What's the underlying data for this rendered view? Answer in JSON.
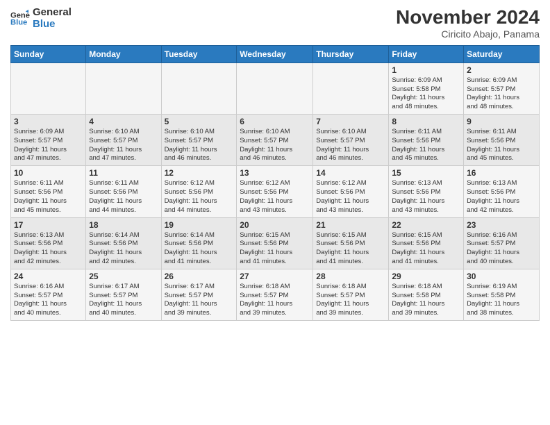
{
  "logo": {
    "line1": "General",
    "line2": "Blue"
  },
  "title": "November 2024",
  "subtitle": "Ciricito Abajo, Panama",
  "weekdays": [
    "Sunday",
    "Monday",
    "Tuesday",
    "Wednesday",
    "Thursday",
    "Friday",
    "Saturday"
  ],
  "weeks": [
    [
      {
        "day": "",
        "info": ""
      },
      {
        "day": "",
        "info": ""
      },
      {
        "day": "",
        "info": ""
      },
      {
        "day": "",
        "info": ""
      },
      {
        "day": "",
        "info": ""
      },
      {
        "day": "1",
        "info": "Sunrise: 6:09 AM\nSunset: 5:58 PM\nDaylight: 11 hours\nand 48 minutes."
      },
      {
        "day": "2",
        "info": "Sunrise: 6:09 AM\nSunset: 5:57 PM\nDaylight: 11 hours\nand 48 minutes."
      }
    ],
    [
      {
        "day": "3",
        "info": "Sunrise: 6:09 AM\nSunset: 5:57 PM\nDaylight: 11 hours\nand 47 minutes."
      },
      {
        "day": "4",
        "info": "Sunrise: 6:10 AM\nSunset: 5:57 PM\nDaylight: 11 hours\nand 47 minutes."
      },
      {
        "day": "5",
        "info": "Sunrise: 6:10 AM\nSunset: 5:57 PM\nDaylight: 11 hours\nand 46 minutes."
      },
      {
        "day": "6",
        "info": "Sunrise: 6:10 AM\nSunset: 5:57 PM\nDaylight: 11 hours\nand 46 minutes."
      },
      {
        "day": "7",
        "info": "Sunrise: 6:10 AM\nSunset: 5:57 PM\nDaylight: 11 hours\nand 46 minutes."
      },
      {
        "day": "8",
        "info": "Sunrise: 6:11 AM\nSunset: 5:56 PM\nDaylight: 11 hours\nand 45 minutes."
      },
      {
        "day": "9",
        "info": "Sunrise: 6:11 AM\nSunset: 5:56 PM\nDaylight: 11 hours\nand 45 minutes."
      }
    ],
    [
      {
        "day": "10",
        "info": "Sunrise: 6:11 AM\nSunset: 5:56 PM\nDaylight: 11 hours\nand 45 minutes."
      },
      {
        "day": "11",
        "info": "Sunrise: 6:11 AM\nSunset: 5:56 PM\nDaylight: 11 hours\nand 44 minutes."
      },
      {
        "day": "12",
        "info": "Sunrise: 6:12 AM\nSunset: 5:56 PM\nDaylight: 11 hours\nand 44 minutes."
      },
      {
        "day": "13",
        "info": "Sunrise: 6:12 AM\nSunset: 5:56 PM\nDaylight: 11 hours\nand 43 minutes."
      },
      {
        "day": "14",
        "info": "Sunrise: 6:12 AM\nSunset: 5:56 PM\nDaylight: 11 hours\nand 43 minutes."
      },
      {
        "day": "15",
        "info": "Sunrise: 6:13 AM\nSunset: 5:56 PM\nDaylight: 11 hours\nand 43 minutes."
      },
      {
        "day": "16",
        "info": "Sunrise: 6:13 AM\nSunset: 5:56 PM\nDaylight: 11 hours\nand 42 minutes."
      }
    ],
    [
      {
        "day": "17",
        "info": "Sunrise: 6:13 AM\nSunset: 5:56 PM\nDaylight: 11 hours\nand 42 minutes."
      },
      {
        "day": "18",
        "info": "Sunrise: 6:14 AM\nSunset: 5:56 PM\nDaylight: 11 hours\nand 42 minutes."
      },
      {
        "day": "19",
        "info": "Sunrise: 6:14 AM\nSunset: 5:56 PM\nDaylight: 11 hours\nand 41 minutes."
      },
      {
        "day": "20",
        "info": "Sunrise: 6:15 AM\nSunset: 5:56 PM\nDaylight: 11 hours\nand 41 minutes."
      },
      {
        "day": "21",
        "info": "Sunrise: 6:15 AM\nSunset: 5:56 PM\nDaylight: 11 hours\nand 41 minutes."
      },
      {
        "day": "22",
        "info": "Sunrise: 6:15 AM\nSunset: 5:56 PM\nDaylight: 11 hours\nand 41 minutes."
      },
      {
        "day": "23",
        "info": "Sunrise: 6:16 AM\nSunset: 5:57 PM\nDaylight: 11 hours\nand 40 minutes."
      }
    ],
    [
      {
        "day": "24",
        "info": "Sunrise: 6:16 AM\nSunset: 5:57 PM\nDaylight: 11 hours\nand 40 minutes."
      },
      {
        "day": "25",
        "info": "Sunrise: 6:17 AM\nSunset: 5:57 PM\nDaylight: 11 hours\nand 40 minutes."
      },
      {
        "day": "26",
        "info": "Sunrise: 6:17 AM\nSunset: 5:57 PM\nDaylight: 11 hours\nand 39 minutes."
      },
      {
        "day": "27",
        "info": "Sunrise: 6:18 AM\nSunset: 5:57 PM\nDaylight: 11 hours\nand 39 minutes."
      },
      {
        "day": "28",
        "info": "Sunrise: 6:18 AM\nSunset: 5:57 PM\nDaylight: 11 hours\nand 39 minutes."
      },
      {
        "day": "29",
        "info": "Sunrise: 6:18 AM\nSunset: 5:58 PM\nDaylight: 11 hours\nand 39 minutes."
      },
      {
        "day": "30",
        "info": "Sunrise: 6:19 AM\nSunset: 5:58 PM\nDaylight: 11 hours\nand 38 minutes."
      }
    ]
  ]
}
